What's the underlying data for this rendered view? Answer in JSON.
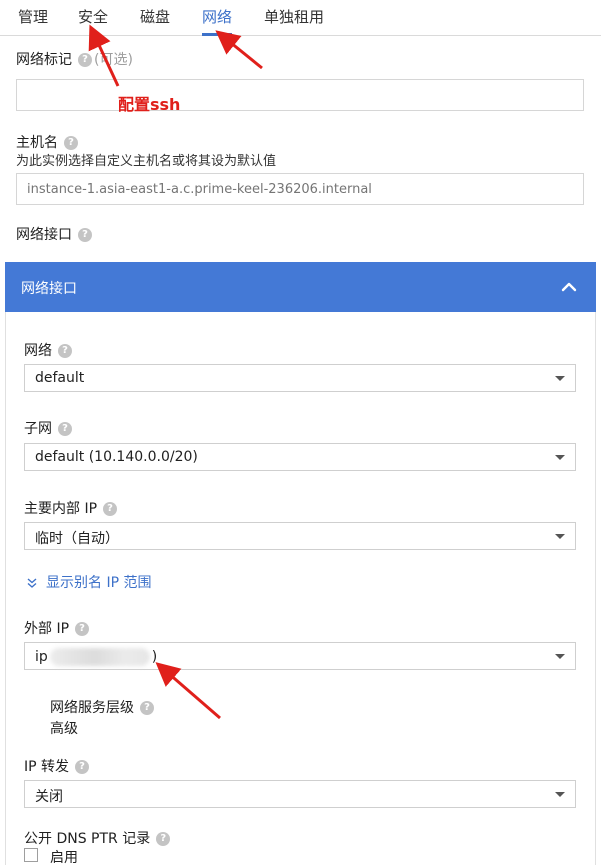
{
  "tabs": [
    {
      "label": "管理",
      "active": false
    },
    {
      "label": "安全",
      "active": false
    },
    {
      "label": "磁盘",
      "active": false
    },
    {
      "label": "网络",
      "active": true
    },
    {
      "label": "单独租用",
      "active": false
    }
  ],
  "network_tags": {
    "label": "网络标记",
    "optional": "(可选)",
    "value": ""
  },
  "annotation": {
    "text": "配置ssh",
    "color": "#e0201b"
  },
  "hostname": {
    "label": "主机名",
    "hint": "为此实例选择自定义主机名或将其设为默认值",
    "placeholder": "instance-1.asia-east1-a.c.prime-keel-236206.internal"
  },
  "network_interfaces_label": "网络接口",
  "panel": {
    "title": "网络接口",
    "network": {
      "label": "网络",
      "value": "default"
    },
    "subnet": {
      "label": "子网",
      "value": "default (10.140.0.0/20)"
    },
    "internal_ip": {
      "label": "主要内部 IP",
      "value": "临时（自动）"
    },
    "show_alias": "显示别名 IP 范围",
    "external_ip": {
      "label": "外部 IP",
      "value_prefix": "ip",
      "value_suffix": ")"
    },
    "tier": {
      "label": "网络服务层级",
      "value": "高级"
    },
    "ip_forwarding": {
      "label": "IP 转发",
      "value": "关闭"
    },
    "dns_ptr": {
      "label": "公开 DNS PTR 记录",
      "checkbox_label": "启用",
      "checked": false
    }
  },
  "colors": {
    "accent": "#4479d6",
    "link": "#3d71c9",
    "annotation": "#e0201b"
  },
  "icons": [
    "help-icon",
    "chevron-up-icon",
    "double-chevron-down-icon",
    "dropdown-caret-icon",
    "checkbox"
  ]
}
